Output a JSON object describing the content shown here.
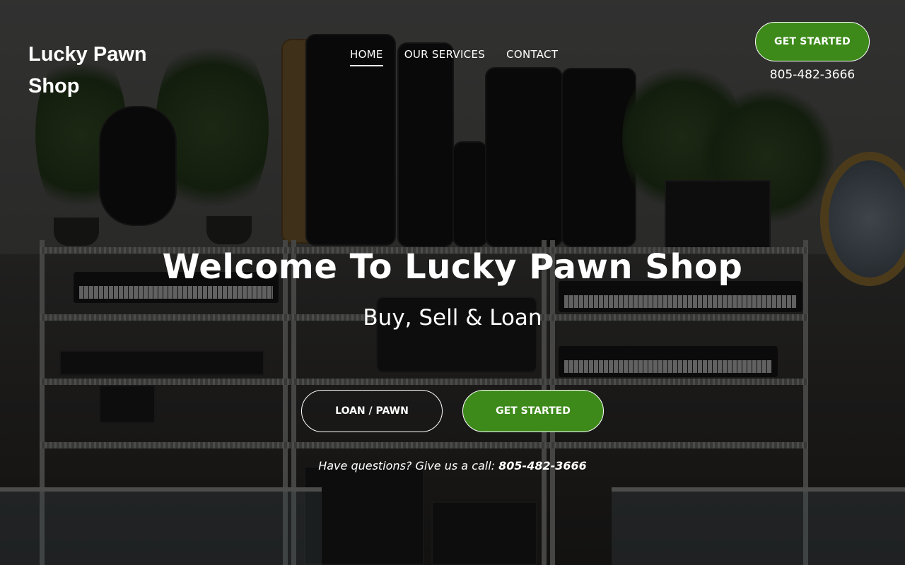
{
  "site": {
    "logo_text": "Lucky Pawn Shop"
  },
  "nav": {
    "items": [
      {
        "label": "HOME",
        "active": true
      },
      {
        "label": "OUR SERVICES",
        "active": false
      },
      {
        "label": "CONTACT",
        "active": false
      }
    ]
  },
  "header": {
    "cta_label": "GET STARTED",
    "phone": "805-482-3666"
  },
  "hero": {
    "title": "Welcome To Lucky Pawn Shop",
    "subtitle": "Buy, Sell & Loan",
    "primary_button": "LOAN / PAWN",
    "secondary_button": "GET STARTED",
    "note_prefix": "Have questions? Give us a call: ",
    "note_phone": "805-482-3666"
  },
  "colors": {
    "accent_green": "#3d8a1a",
    "overlay": "rgba(0,0,0,0.55)"
  }
}
